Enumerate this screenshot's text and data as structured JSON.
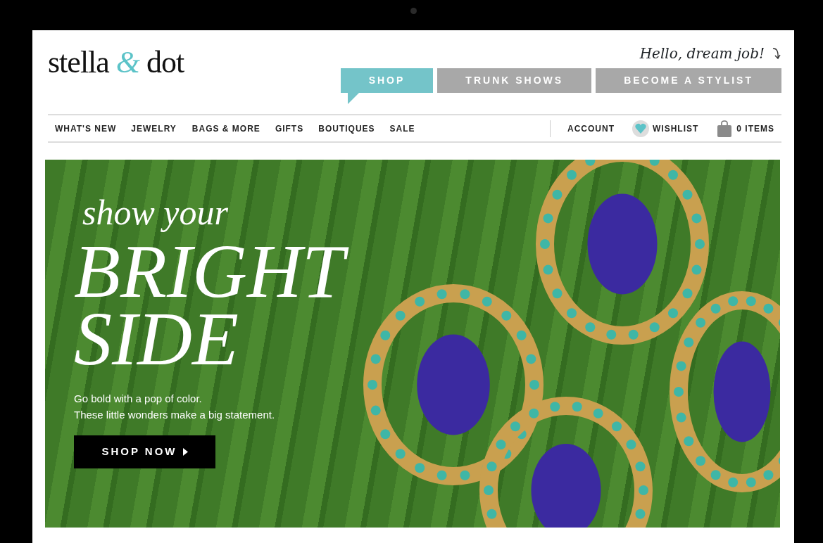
{
  "logo": {
    "before": "stella",
    "mark": "&",
    "after": "dot"
  },
  "tagline": "Hello, dream job!",
  "top_tabs": [
    {
      "label": "SHOP",
      "selected": true
    },
    {
      "label": "TRUNK SHOWS",
      "selected": false
    },
    {
      "label": "BECOME A STYLIST",
      "selected": false
    }
  ],
  "nav_links": [
    "WHAT'S NEW",
    "JEWELRY",
    "BAGS & MORE",
    "GIFTS",
    "BOUTIQUES",
    "SALE"
  ],
  "account_links": [
    {
      "kind": "text",
      "label": "ACCOUNT"
    },
    {
      "kind": "wishlist",
      "label": "WISHLIST"
    },
    {
      "kind": "bag",
      "label": "0 ITEMS"
    }
  ],
  "hero": {
    "kicker": "show your",
    "headline": [
      "BRIGHT",
      "SIDE"
    ],
    "body": [
      "Go bold with a pop of color.",
      "These little wonders make a big statement."
    ],
    "button": {
      "label": "SHOP NOW"
    }
  }
}
